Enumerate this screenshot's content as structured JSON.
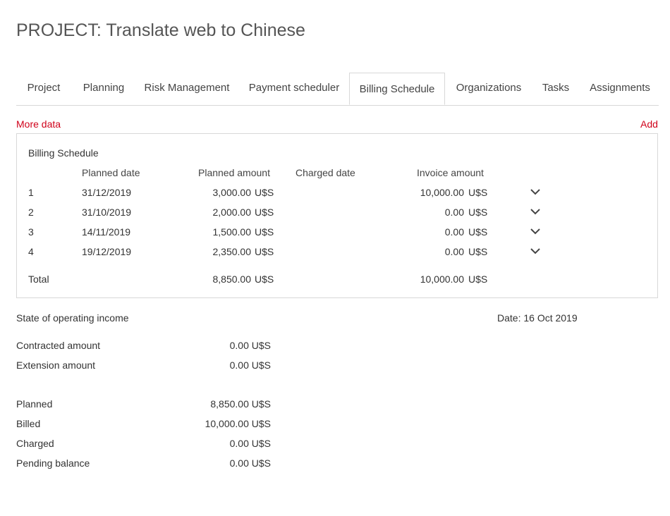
{
  "page": {
    "title": "PROJECT: Translate web to Chinese"
  },
  "tabs": [
    {
      "label": "Project"
    },
    {
      "label": "Planning"
    },
    {
      "label": "Risk Management"
    },
    {
      "label": "Payment scheduler"
    },
    {
      "label": "Billing Schedule",
      "active": true
    },
    {
      "label": "Organizations"
    },
    {
      "label": "Tasks"
    },
    {
      "label": "Assignments"
    }
  ],
  "actions": {
    "more_data": "More data",
    "add": "Add"
  },
  "billing": {
    "title": "Billing Schedule",
    "columns": {
      "planned_date": "Planned date",
      "planned_amount": "Planned amount",
      "charged_date": "Charged date",
      "invoice_amount": "Invoice amount"
    },
    "currency": "U$S",
    "rows": [
      {
        "num": "1",
        "planned_date": "31/12/2019",
        "planned_amount": "3,000.00",
        "charged_date": "",
        "invoice_amount": "10,000.00"
      },
      {
        "num": "2",
        "planned_date": "31/10/2019",
        "planned_amount": "2,000.00",
        "charged_date": "",
        "invoice_amount": "0.00"
      },
      {
        "num": "3",
        "planned_date": "14/11/2019",
        "planned_amount": "1,500.00",
        "charged_date": "",
        "invoice_amount": "0.00"
      },
      {
        "num": "4",
        "planned_date": "19/12/2019",
        "planned_amount": "2,350.00",
        "charged_date": "",
        "invoice_amount": "0.00"
      }
    ],
    "total": {
      "label": "Total",
      "planned_amount": "8,850.00",
      "invoice_amount": "10,000.00"
    }
  },
  "income": {
    "title": "State of operating income",
    "date": "Date: 16 Oct 2019",
    "contracted": {
      "label": "Contracted amount",
      "value": "0.00 U$S"
    },
    "extension": {
      "label": "Extension amount",
      "value": "0.00 U$S"
    },
    "planned": {
      "label": "Planned",
      "value": "8,850.00 U$S"
    },
    "billed": {
      "label": "Billed",
      "value": "10,000.00 U$S"
    },
    "charged": {
      "label": "Charged",
      "value": "0.00 U$S"
    },
    "pending": {
      "label": "Pending balance",
      "value": "0.00 U$S"
    }
  },
  "colors": {
    "accent_red": "#d0021b",
    "link_blue": "#1a1ad0",
    "planned_orange": "#e09010"
  },
  "icons": {
    "row_expand": "chevron-down-icon"
  }
}
